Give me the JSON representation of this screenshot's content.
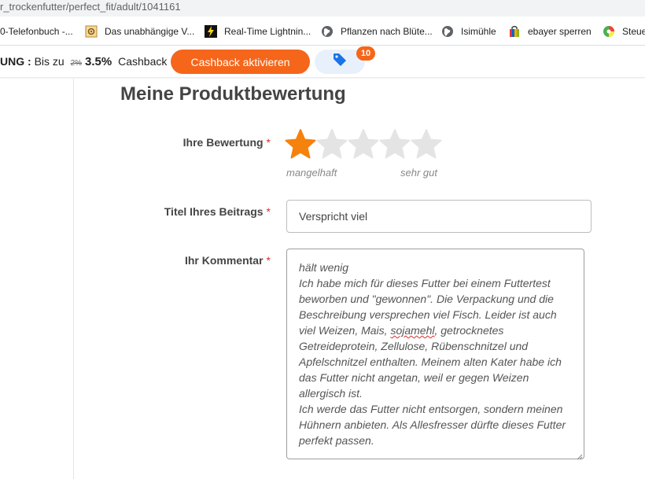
{
  "browser": {
    "url": "r_trockenfutter/perfect_fit/adult/1041161",
    "bookmarks": [
      {
        "label": "0-Telefonbuch -...",
        "icon": "phonebook-icon"
      },
      {
        "label": "Das unabhängige V...",
        "icon": "gear-favicon-icon"
      },
      {
        "label": "Real-Time Lightnin...",
        "icon": "lightning-icon"
      },
      {
        "label": "Pflanzen nach Blüte...",
        "icon": "globe-icon"
      },
      {
        "label": "Isimühle",
        "icon": "globe-icon"
      },
      {
        "label": "ebayer sperren",
        "icon": "shopping-bag-icon"
      },
      {
        "label": "Steue",
        "icon": "color-wheel-icon"
      }
    ]
  },
  "cashback": {
    "prefix": "UNG :",
    "text_bis": "Bis zu",
    "old_rate": "2%",
    "rate": "3.5%",
    "label": "Cashback",
    "button": "Cashback aktivieren",
    "tag_icon": "price-tag-icon",
    "badge_count": "10"
  },
  "form": {
    "heading": "Meine Produktbewertung",
    "rating": {
      "label": "Ihre Bewertung",
      "required_mark": "*",
      "value": 1,
      "max": 5,
      "low_label": "mangelhaft",
      "high_label": "sehr gut",
      "colors": {
        "active": "#f5820d",
        "inactive": "#e4e4e4"
      }
    },
    "title": {
      "label": "Titel Ihres Beitrags",
      "required_mark": "*",
      "value": "Verspricht viel"
    },
    "comment": {
      "label": "Ihr Kommentar",
      "required_mark": "*",
      "line1": "hält wenig",
      "para_a": "Ich habe mich für dieses Futter bei einem Futtertest beworben und \"gewonnen\". Die Verpackung und die Beschreibung versprechen viel Fisch. Leider ist auch viel Weizen, Mais,",
      "misspelled": "sojamehl",
      "para_b": ", getrocknetes Getreideprotein, Zellulose, Rübenschnitzel und Apfelschnitzel enthalten. Meinem alten Kater habe ich das Futter nicht angetan, weil er gegen Weizen allergisch ist.",
      "para_c": "Ich werde das Futter nicht entsorgen, sondern meinen Hühnern anbieten. Als Allesfresser dürfte dieses Futter perfekt passen."
    }
  }
}
